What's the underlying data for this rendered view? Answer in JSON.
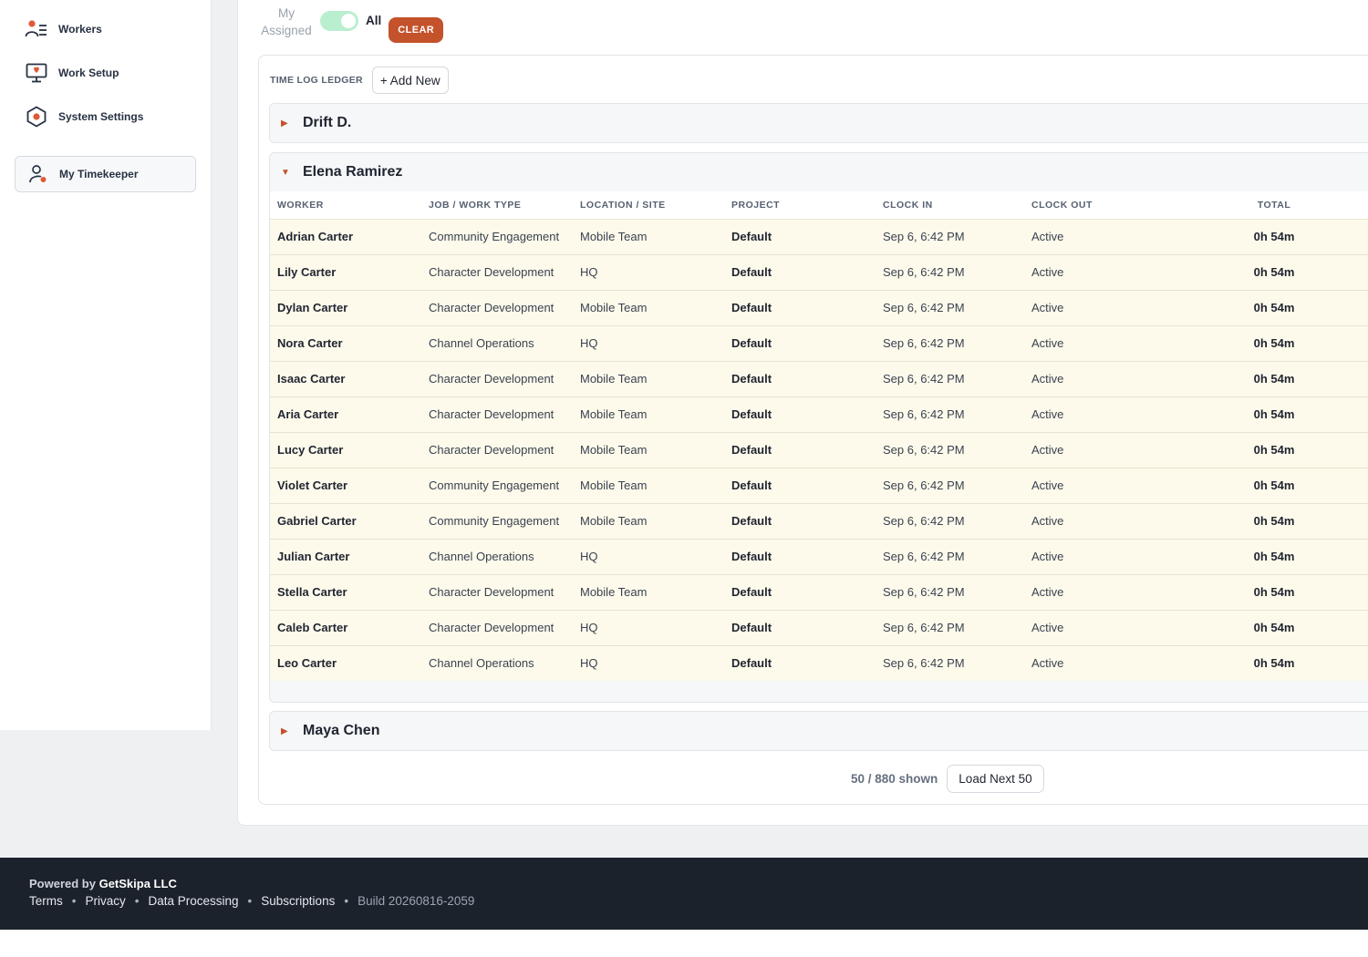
{
  "sidebar": {
    "items": [
      {
        "label": "Workers",
        "icon": "workers-icon"
      },
      {
        "label": "Work Setup",
        "icon": "monitor-icon"
      },
      {
        "label": "System Settings",
        "icon": "settings-hex-icon"
      }
    ],
    "active_item": {
      "label": "My Timekeeper",
      "icon": "person-clock-icon"
    }
  },
  "filter": {
    "assigned_label": "My Assigned",
    "all_label": "All",
    "clear_label": "CLEAR",
    "toggle_on": true
  },
  "ledger": {
    "title": "TIME LOG LEDGER",
    "add_new_label": "+ Add New",
    "columns": [
      "WORKER",
      "JOB / WORK TYPE",
      "LOCATION / SITE",
      "PROJECT",
      "CLOCK IN",
      "CLOCK OUT",
      "TOTAL"
    ],
    "groups": [
      {
        "name": "Drift D.",
        "expanded": false
      },
      {
        "name": "Elena Ramirez",
        "expanded": true
      },
      {
        "name": "Maya Chen",
        "expanded": false
      }
    ],
    "rows": [
      [
        "Adrian Carter",
        "Community Engagement",
        "Mobile Team",
        "Default",
        "Sep 6, 6:42 PM",
        "Active",
        "0h 54m"
      ],
      [
        "Lily Carter",
        "Character Development",
        "HQ",
        "Default",
        "Sep 6, 6:42 PM",
        "Active",
        "0h 54m"
      ],
      [
        "Dylan Carter",
        "Character Development",
        "Mobile Team",
        "Default",
        "Sep 6, 6:42 PM",
        "Active",
        "0h 54m"
      ],
      [
        "Nora Carter",
        "Channel Operations",
        "HQ",
        "Default",
        "Sep 6, 6:42 PM",
        "Active",
        "0h 54m"
      ],
      [
        "Isaac Carter",
        "Character Development",
        "Mobile Team",
        "Default",
        "Sep 6, 6:42 PM",
        "Active",
        "0h 54m"
      ],
      [
        "Aria Carter",
        "Character Development",
        "Mobile Team",
        "Default",
        "Sep 6, 6:42 PM",
        "Active",
        "0h 54m"
      ],
      [
        "Lucy Carter",
        "Character Development",
        "Mobile Team",
        "Default",
        "Sep 6, 6:42 PM",
        "Active",
        "0h 54m"
      ],
      [
        "Violet Carter",
        "Community Engagement",
        "Mobile Team",
        "Default",
        "Sep 6, 6:42 PM",
        "Active",
        "0h 54m"
      ],
      [
        "Gabriel Carter",
        "Community Engagement",
        "Mobile Team",
        "Default",
        "Sep 6, 6:42 PM",
        "Active",
        "0h 54m"
      ],
      [
        "Julian Carter",
        "Channel Operations",
        "HQ",
        "Default",
        "Sep 6, 6:42 PM",
        "Active",
        "0h 54m"
      ],
      [
        "Stella Carter",
        "Character Development",
        "Mobile Team",
        "Default",
        "Sep 6, 6:42 PM",
        "Active",
        "0h 54m"
      ],
      [
        "Caleb Carter",
        "Character Development",
        "HQ",
        "Default",
        "Sep 6, 6:42 PM",
        "Active",
        "0h 54m"
      ],
      [
        "Leo Carter",
        "Channel Operations",
        "HQ",
        "Default",
        "Sep 6, 6:42 PM",
        "Active",
        "0h 54m"
      ]
    ],
    "pager": {
      "count_label": "50 / 880 shown",
      "load_next_label": "Load Next 50"
    }
  },
  "footer": {
    "powered_prefix": "Powered by",
    "company": "GetSkipa LLC",
    "links": [
      "Terms",
      "Privacy",
      "Data Processing",
      "Subscriptions"
    ],
    "separator": "•",
    "build": "Build 20260816-2059"
  },
  "colors": {
    "accent": "#c4522a",
    "toggle_on": "#b9efcf",
    "row_bg": "#fdfaeb",
    "footer_bg": "#1c222c"
  }
}
